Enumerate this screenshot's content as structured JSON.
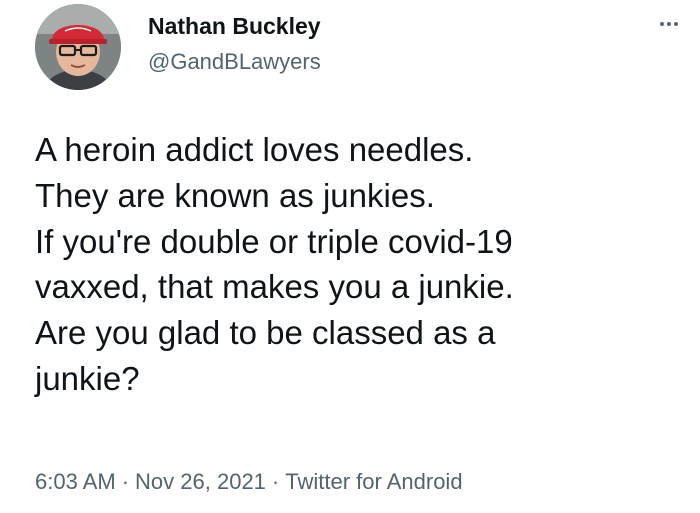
{
  "author": {
    "display_name": "Nathan Buckley",
    "handle": "@GandBLawyers",
    "avatar_icon": "user-avatar-red-cap"
  },
  "more_icon": "ellipsis-icon",
  "tweet": {
    "lines": [
      "A heroin addict loves needles.",
      "They are known as junkies.",
      "If you're double or triple covid-19",
      "vaxxed, that makes you a junkie.",
      "Are you glad to be classed as a",
      "junkie?"
    ]
  },
  "meta": {
    "time": "6:03 AM",
    "separator": "·",
    "date": "Nov 26, 2021",
    "source": "Twitter for Android"
  },
  "colors": {
    "text_primary": "#0f1419",
    "text_secondary": "#536471",
    "background": "#ffffff",
    "cap_red": "#d32a35"
  }
}
